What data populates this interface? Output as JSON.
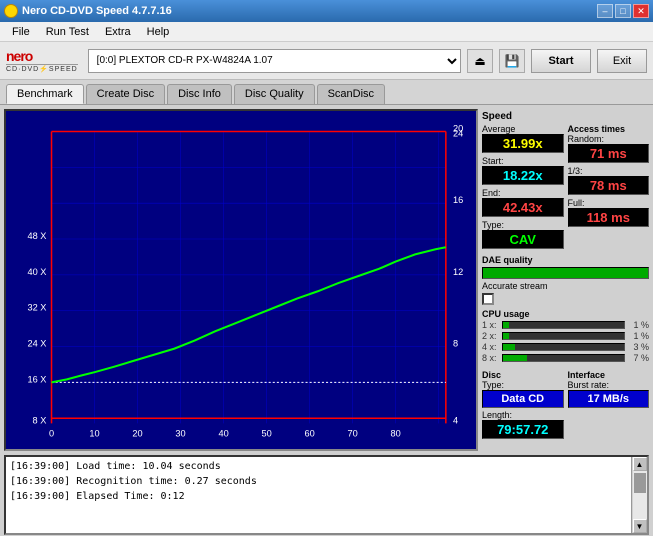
{
  "titleBar": {
    "title": "Nero CD-DVD Speed 4.7.7.16",
    "controls": [
      "–",
      "□",
      "✕"
    ]
  },
  "menuBar": {
    "items": [
      "File",
      "Run Test",
      "Extra",
      "Help"
    ]
  },
  "toolbar": {
    "drive": "[0:0]  PLEXTOR CD-R  PX-W4824A 1.07",
    "startLabel": "Start",
    "exitLabel": "Exit"
  },
  "tabs": {
    "items": [
      "Benchmark",
      "Create Disc",
      "Disc Info",
      "Disc Quality",
      "ScanDisc"
    ],
    "active": 0
  },
  "speedPanel": {
    "sectionLabel": "Speed",
    "averageLabel": "Average",
    "averageValue": "31.99x",
    "startLabel": "Start:",
    "startValue": "18.22x",
    "endLabel": "End:",
    "endValue": "42.43x",
    "typeLabel": "Type:",
    "typeValue": "CAV",
    "accessTimesLabel": "Access times",
    "randomLabel": "Random:",
    "randomValue": "71 ms",
    "oneThirdLabel": "1/3:",
    "oneThirdValue": "78 ms",
    "fullLabel": "Full:",
    "fullValue": "118 ms"
  },
  "daePanel": {
    "label": "DAE quality",
    "barFill": 100,
    "accurateStreamLabel": "Accurate stream",
    "checked": false
  },
  "cpuPanel": {
    "label": "CPU usage",
    "rows": [
      {
        "speed": "1 x:",
        "value": "1 %",
        "fill": 5
      },
      {
        "speed": "2 x:",
        "value": "1 %",
        "fill": 5
      },
      {
        "speed": "4 x:",
        "value": "3 %",
        "fill": 10
      },
      {
        "speed": "8 x:",
        "value": "7 %",
        "fill": 20
      }
    ]
  },
  "discPanel": {
    "label": "Disc",
    "typeLabel": "Type:",
    "typeValue": "Data CD",
    "lengthLabel": "Length:",
    "lengthValue": "79:57.72",
    "interfaceLabel": "Interface",
    "burstLabel": "Burst rate:",
    "burstValue": "17 MB/s"
  },
  "chart": {
    "xLabels": [
      "0",
      "10",
      "20",
      "30",
      "40",
      "50",
      "60",
      "70",
      "80"
    ],
    "yLabels": [
      "8 X",
      "16 X",
      "24 X",
      "32 X",
      "40 X",
      "48 X"
    ],
    "rightLabels": [
      "4",
      "8",
      "12",
      "16",
      "20",
      "24"
    ]
  },
  "log": {
    "lines": [
      "[16:39:00]   Load time: 10.04 seconds",
      "[16:39:00]   Recognition time: 0.27 seconds",
      "[16:39:00]   Elapsed Time: 0:12"
    ]
  }
}
